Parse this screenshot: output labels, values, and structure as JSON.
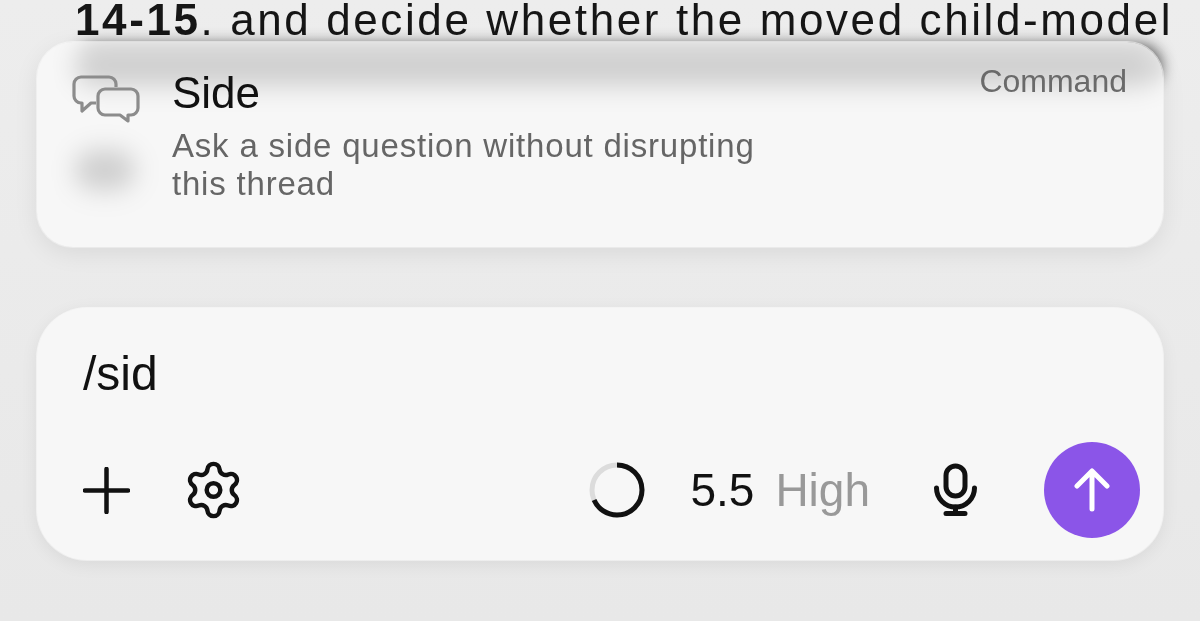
{
  "background_text": "**14-15**. and decide whether the moved child-model",
  "command_popup": {
    "items": [
      {
        "title": "Side",
        "description": "Ask a side question without disrupting this thread",
        "type_label": "Command"
      }
    ]
  },
  "composer": {
    "value": "/sid",
    "usage": {
      "level": 0.68
    },
    "model": {
      "version": "5.5",
      "effort": "High"
    }
  }
}
